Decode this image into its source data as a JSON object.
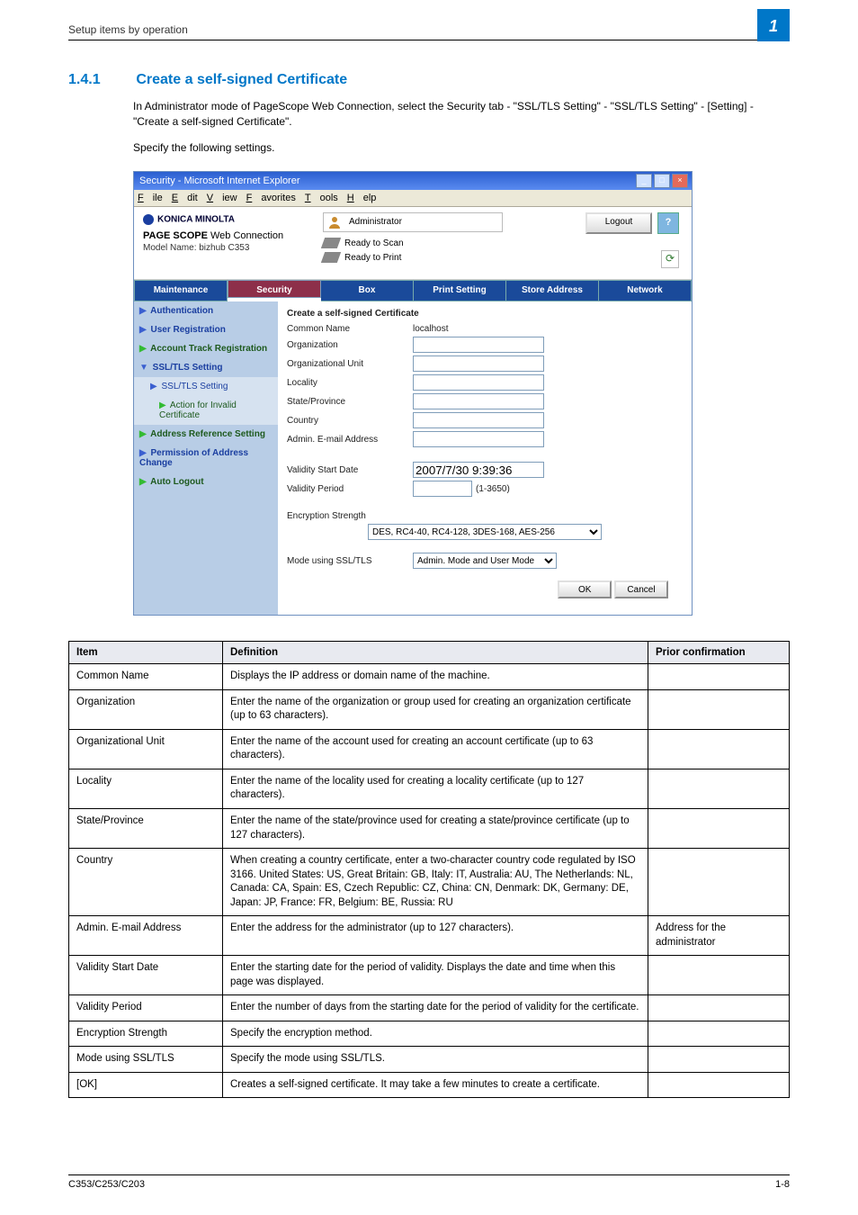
{
  "header": {
    "breadcrumb": "Setup items by operation",
    "badge": "1"
  },
  "section": {
    "num": "1.4.1",
    "title": "Create a self-signed Certificate",
    "para1": "In Administrator mode of PageScope Web Connection, select the Security tab - \"SSL/TLS Setting\" - \"SSL/TLS Setting\" - [Setting] - \"Create a self-signed Certificate\".",
    "para2": "Specify the following settings."
  },
  "ie": {
    "title": "Security - Microsoft Internet Explorer",
    "menu": [
      "File",
      "Edit",
      "View",
      "Favorites",
      "Tools",
      "Help"
    ]
  },
  "wc": {
    "brand": "KONICA MINOLTA",
    "line2_pre": "PAGE SCOPE",
    "line2": "Web Connection",
    "model": "Model Name: bizhub C353",
    "admin": "Administrator",
    "status1": "Ready to Scan",
    "status2": "Ready to Print",
    "logout": "Logout",
    "help": "?",
    "refresh": "⟳"
  },
  "tabs": [
    "Maintenance",
    "Security",
    "Box",
    "Print Setting",
    "Store Address",
    "Network"
  ],
  "tab_selected": 1,
  "sidebar": [
    {
      "label": "Authentication",
      "cls": "blue",
      "arr": "▶"
    },
    {
      "label": "User Registration",
      "cls": "blue",
      "arr": "▶"
    },
    {
      "label": "Account Track Registration",
      "cls": "",
      "arr": "▶"
    },
    {
      "label": "SSL/TLS Setting",
      "cls": "blue",
      "arr": "▼"
    },
    {
      "label": "SSL/TLS Setting",
      "cls": "sub blue",
      "arr": "▶"
    },
    {
      "label": "Action for Invalid Certificate",
      "cls": "sub lvl2",
      "arr": "▶"
    },
    {
      "label": "Address Reference Setting",
      "cls": "",
      "arr": "▶"
    },
    {
      "label": "Permission of Address Change",
      "cls": "blue",
      "arr": "▶"
    },
    {
      "label": "Auto Logout",
      "cls": "",
      "arr": "▶"
    }
  ],
  "form": {
    "title": "Create a self-signed Certificate",
    "rows": [
      {
        "lbl": "Common Name",
        "val": "localhost",
        "ro": true
      },
      {
        "lbl": "Organization",
        "val": ""
      },
      {
        "lbl": "Organizational Unit",
        "val": ""
      },
      {
        "lbl": "Locality",
        "val": ""
      },
      {
        "lbl": "State/Province",
        "val": ""
      },
      {
        "lbl": "Country",
        "val": ""
      },
      {
        "lbl": "Admin. E-mail Address",
        "val": ""
      }
    ],
    "start_lbl": "Validity Start Date",
    "start_val": "2007/7/30 9:39:36",
    "period_lbl": "Validity Period",
    "period_val": "",
    "period_hint": "(1-3650)",
    "enc_lbl": "Encryption Strength",
    "enc_val": "DES, RC4-40, RC4-128, 3DES-168, AES-256",
    "mode_lbl": "Mode using SSL/TLS",
    "mode_val": "Admin. Mode and User Mode",
    "ok": "OK",
    "cancel": "Cancel"
  },
  "table": {
    "h1": "Item",
    "h2": "Definition",
    "h3": "Prior confirmation",
    "rows": [
      {
        "c1": "Common Name",
        "c2": "Displays the IP address or domain name of the machine.",
        "c3": ""
      },
      {
        "c1": "Organization",
        "c2": "Enter the name of the organization or group used for creating an organization certificate (up to 63 characters).",
        "c3": ""
      },
      {
        "c1": "Organizational Unit",
        "c2": "Enter the name of the account used for creating an account certificate (up to 63 characters).",
        "c3": ""
      },
      {
        "c1": "Locality",
        "c2": "Enter the name of the locality used for creating a locality certificate (up to 127 characters).",
        "c3": ""
      },
      {
        "c1": "State/Province",
        "c2": "Enter the name of the state/province used for creating a state/province certificate (up to 127 characters).",
        "c3": ""
      },
      {
        "c1": "Country",
        "c2": "When creating a country certificate, enter a two-character country code regulated by ISO 3166.\nUnited States: US, Great Britain: GB, Italy: IT, Australia: AU, The Netherlands: NL, Canada: CA, Spain: ES, Czech Republic: CZ, China: CN, Denmark: DK, Germany: DE, Japan: JP, France: FR, Belgium: BE, Russia: RU",
        "c3": ""
      },
      {
        "c1": "Admin. E-mail Address",
        "c2": "Enter the address for the administrator (up to 127 characters).",
        "c3": "Address for the administrator"
      },
      {
        "c1": "Validity Start Date",
        "c2": "Enter the starting date for the period of validity. Displays the date and time when this page was displayed.",
        "c3": ""
      },
      {
        "c1": "Validity Period",
        "c2": "Enter the number of days from the starting date for the period of validity for the certificate.",
        "c3": ""
      },
      {
        "c1": "Encryption Strength",
        "c2": "Specify the encryption method.",
        "c3": ""
      },
      {
        "c1": "Mode using SSL/TLS",
        "c2": "Specify the mode using SSL/TLS.",
        "c3": ""
      },
      {
        "c1": "[OK]",
        "c2": "Creates a self-signed certificate. It may take a few minutes to create a certificate.",
        "c3": ""
      }
    ]
  },
  "footer": {
    "left": "C353/C253/C203",
    "right": "1-8"
  }
}
